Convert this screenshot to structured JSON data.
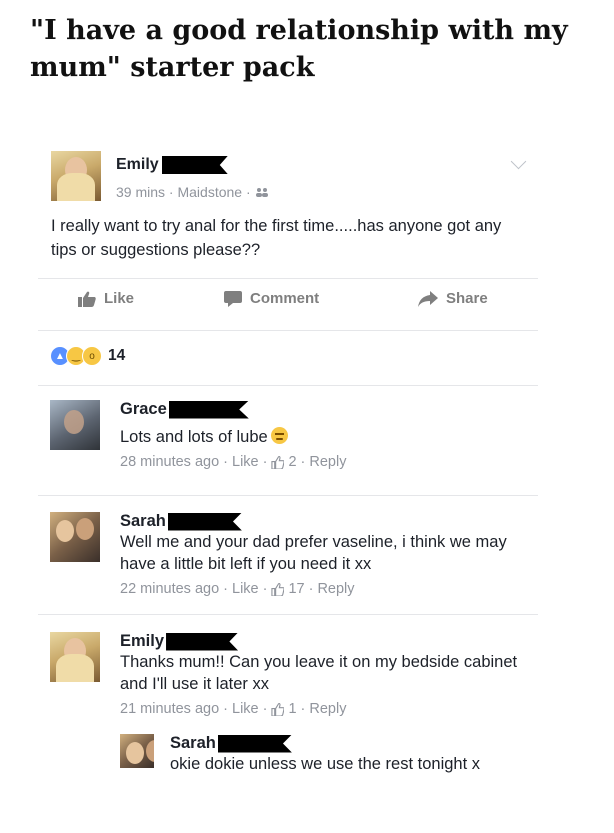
{
  "meme_title": "\"I have a good relationship with my mum\" starter pack",
  "post": {
    "author": "Emily",
    "time": "39 mins",
    "location": "Maidstone",
    "privacy_icon": "friends-icon",
    "text": "I really want to try anal for the first time.....has anyone got any tips or suggestions please??",
    "actions": {
      "like": "Like",
      "comment": "Comment",
      "share": "Share"
    },
    "reaction_count": "14",
    "reactions": [
      "like",
      "haha",
      "wow"
    ]
  },
  "comments": [
    {
      "author": "Grace",
      "text": "Lots and lots of lube",
      "time": "28 minutes ago",
      "like": "Like",
      "likes": "2",
      "reply": "Reply"
    },
    {
      "author": "Sarah",
      "text": "Well me and your dad prefer vaseline, i think we may have a little bit left if you need it xx",
      "time": "22 minutes ago",
      "like": "Like",
      "likes": "17",
      "reply": "Reply"
    },
    {
      "author": "Emily",
      "text": "Thanks mum!! Can you leave it on my bedside cabinet and I'll use it later xx",
      "time": "21 minutes ago",
      "like": "Like",
      "likes": "1",
      "reply": "Reply"
    }
  ],
  "reply": {
    "author": "Sarah",
    "text": "okie dokie unless we use the rest tonight x"
  },
  "colors": {
    "meta": "#90949c",
    "like_blue": "#5890ff",
    "divider": "#e5e6e9"
  }
}
